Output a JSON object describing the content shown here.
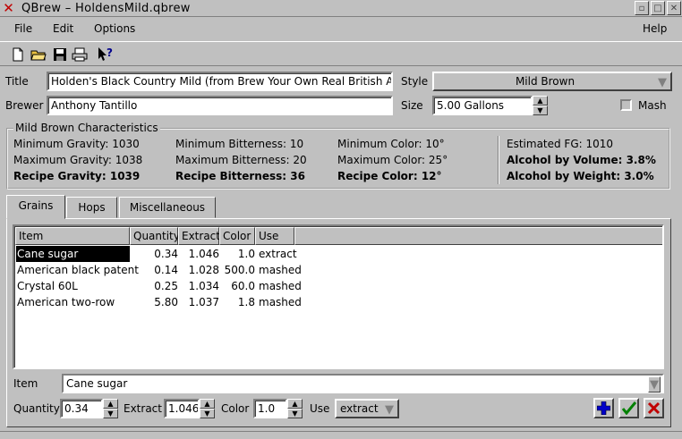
{
  "window": {
    "title": "QBrew – HoldensMild.qbrew"
  },
  "menu": {
    "file": "File",
    "edit": "Edit",
    "options": "Options",
    "help": "Help"
  },
  "toolbar": {
    "icons": [
      "new-file-icon",
      "open-folder-icon",
      "save-icon",
      "print-icon",
      "whats-this-icon"
    ]
  },
  "recipe": {
    "title_label": "Title",
    "title_value": "Holden's Black Country Mild (from Brew Your Own Real British Ale)",
    "brewer_label": "Brewer",
    "brewer_value": "Anthony Tantillo",
    "style_label": "Style",
    "style_value": "Mild Brown",
    "size_label": "Size",
    "size_value": "5.00 Gallons",
    "mash_label": "Mash",
    "mash_checked": false
  },
  "characteristics": {
    "title": "Mild Brown Characteristics",
    "min_gravity": "Minimum Gravity: 1030",
    "max_gravity": "Maximum Gravity: 1038",
    "recipe_gravity": "Recipe Gravity: 1039",
    "min_bitterness": "Minimum Bitterness: 10",
    "max_bitterness": "Maximum Bitterness: 20",
    "recipe_bitterness": "Recipe Bitterness: 36",
    "min_color": "Minimum Color: 10°",
    "max_color": "Maximum Color: 25°",
    "recipe_color": "Recipe Color: 12°",
    "estimated_fg": "Estimated FG: 1010",
    "abv": "Alcohol by Volume: 3.8%",
    "abw": "Alcohol by Weight: 3.0%"
  },
  "tabs": {
    "grains": "Grains",
    "hops": "Hops",
    "misc": "Miscellaneous"
  },
  "grains_table": {
    "headers": {
      "item": "Item",
      "quantity": "Quantity",
      "extract": "Extract",
      "color": "Color",
      "use": "Use"
    },
    "rows": [
      {
        "item": "Cane sugar",
        "quantity": "0.34",
        "extract": "1.046",
        "color": "1.0",
        "use": "extract"
      },
      {
        "item": "American black patent",
        "quantity": "0.14",
        "extract": "1.028",
        "color": "500.0",
        "use": "mashed"
      },
      {
        "item": "Crystal 60L",
        "quantity": "0.25",
        "extract": "1.034",
        "color": "60.0",
        "use": "mashed"
      },
      {
        "item": "American two-row",
        "quantity": "5.80",
        "extract": "1.037",
        "color": "1.8",
        "use": "mashed"
      }
    ]
  },
  "editor": {
    "item_label": "Item",
    "item_value": "Cane sugar",
    "quantity_label": "Quantity",
    "quantity_value": "0.34",
    "extract_label": "Extract",
    "extract_value": "1.046",
    "color_label": "Color",
    "color_value": "1.0",
    "use_label": "Use",
    "use_value": "extract"
  },
  "colors": {
    "add": "#0000c8",
    "apply": "#008000",
    "remove": "#c00000"
  }
}
